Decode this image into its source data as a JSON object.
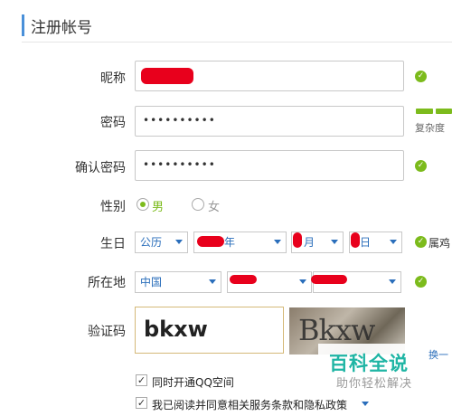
{
  "header": {
    "title": "注册帐号"
  },
  "form": {
    "nickname": {
      "label": "昵称"
    },
    "password": {
      "label": "密码",
      "value": "••••••••••",
      "strength_text": "复杂度"
    },
    "confirm": {
      "label": "确认密码",
      "value": "••••••••••"
    },
    "gender": {
      "label": "性别",
      "options": [
        "男",
        "女"
      ],
      "selected": "男"
    },
    "birthday": {
      "label": "生日",
      "calendar": "公历",
      "year_suffix": "年",
      "month_suffix": "月",
      "day_suffix": "日",
      "note": "属鸡"
    },
    "location": {
      "label": "所在地",
      "country": "中国"
    },
    "captcha": {
      "label": "验证码",
      "value": "bkxw",
      "image_text": "Bkxw",
      "refresh_text": "换一"
    }
  },
  "checks": {
    "qzone": "同时开通QQ空间",
    "agree": "我已阅读并同意相关服务条款和隐私政策"
  },
  "watermark": {
    "title": "百科全说",
    "subtitle": "助你轻松解决"
  },
  "colors": {
    "accent": "#4a90d9",
    "ok": "#7cbb1c",
    "redact": "#e8001c",
    "select_text": "#2a6ebb"
  }
}
